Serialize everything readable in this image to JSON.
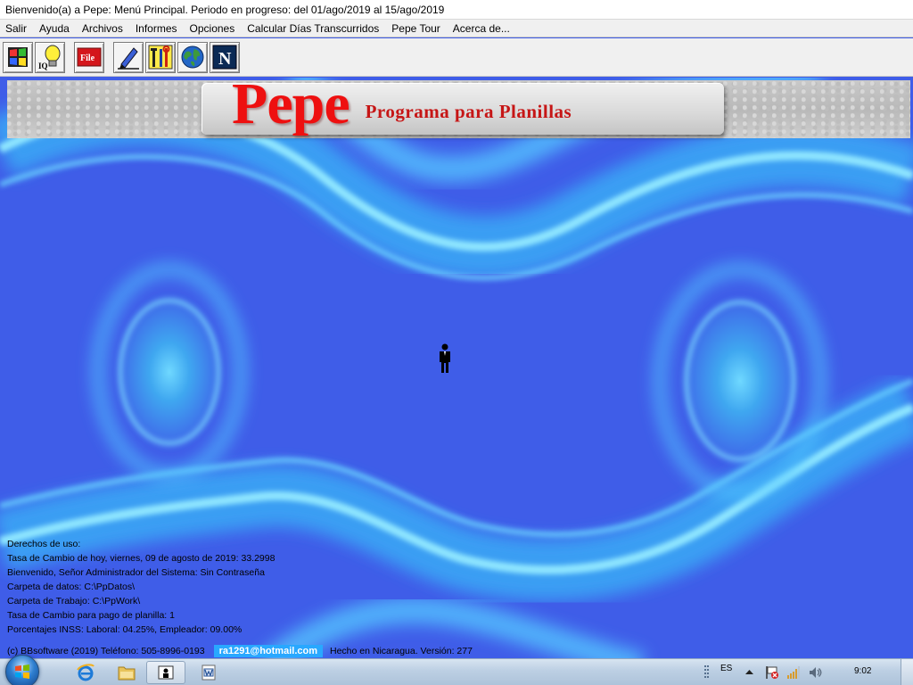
{
  "window": {
    "title": "Bienvenido(a) a Pepe: Menú Principal. Periodo en progreso: del 01/ago/2019 al 15/ago/2019"
  },
  "menu": {
    "items": [
      "Salir",
      "Ayuda",
      "Archivos",
      "Informes",
      "Opciones",
      "Calcular Días Transcurridos",
      "Pepe Tour",
      "Acerca de..."
    ]
  },
  "toolbar": {
    "buttons": [
      {
        "icon": "windows-flag-icon"
      },
      {
        "icon": "lightbulb-iq-icon",
        "label": "IQ"
      },
      {
        "icon": "file-icon",
        "label": "File"
      },
      {
        "icon": "pen-icon"
      },
      {
        "icon": "tools-icon"
      },
      {
        "icon": "globe-icon"
      },
      {
        "icon": "netscape-icon",
        "label": "N"
      }
    ]
  },
  "banner": {
    "logo": "Pepe",
    "subtitle": "Programa para Planillas"
  },
  "info": {
    "lines": [
      "Derechos de uso:",
      "Tasa de Cambio de hoy, viernes, 09 de agosto de 2019: 33.2998",
      "Bienvenido, Señor Administrador del Sistema: Sin Contraseña",
      "Carpeta de datos: C:\\PpDatos\\",
      "Carpeta de Trabajo: C:\\PpWork\\",
      "Tasa de Cambio para pago de planilla: 1",
      "Porcentajes INSS: Laboral: 04.25%, Empleador: 09.00%"
    ]
  },
  "footer": {
    "copyright": "(c) BBsoftware (2019)   Teléfono: 505-8996-0193",
    "email": "ra1291@hotmail.com",
    "made_in": "Hecho en Nicaragua. Versión: 277"
  },
  "taskbar": {
    "language": "ES",
    "time": "9:02",
    "apps": [
      "internet-explorer-icon",
      "folder-icon",
      "pepe-app-icon",
      "word-document-icon"
    ]
  },
  "colors": {
    "desktop_blue": "#3f5de8",
    "wave_cyan": "#52c8ff",
    "logo_red": "#ee1010",
    "email_badge": "#29a8ff"
  }
}
